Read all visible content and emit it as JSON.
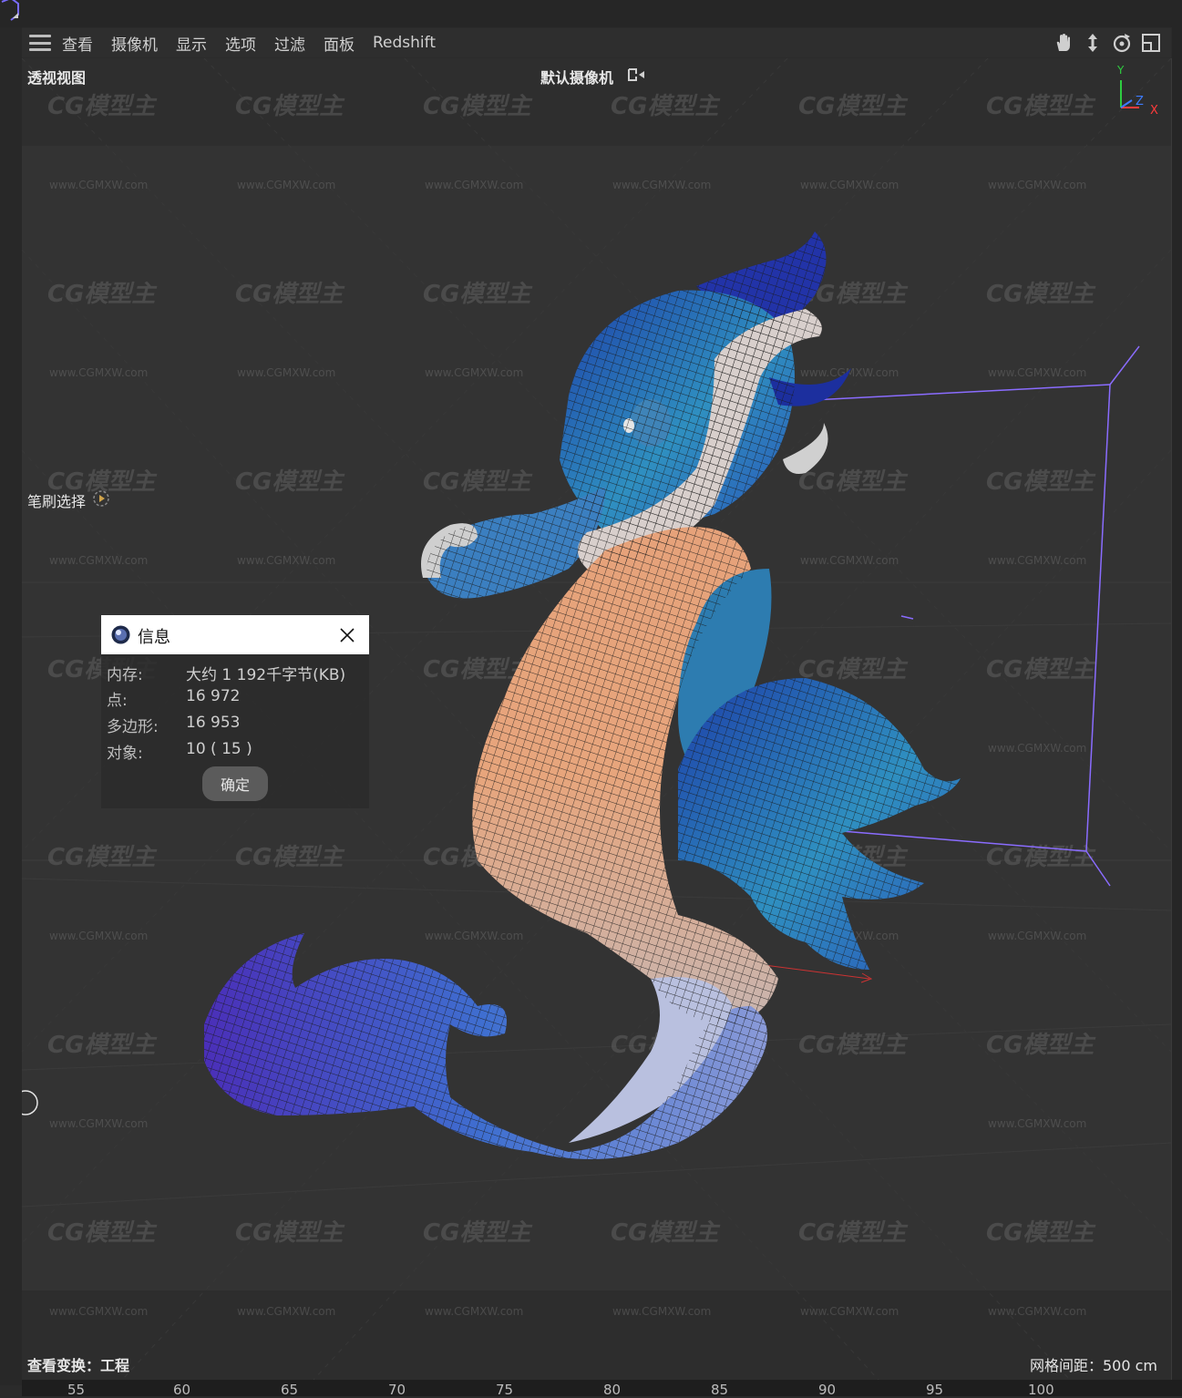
{
  "menubar": {
    "items": [
      "查看",
      "摄像机",
      "显示",
      "选项",
      "过滤",
      "面板",
      "Redshift"
    ]
  },
  "viewport": {
    "view_name": "透视视图",
    "camera_name": "默认摄像机",
    "brush_select": "笔刷选择",
    "view_transform": "查看变换：工程",
    "grid_spacing": "网格间距：500 cm",
    "axis": {
      "y": "Y",
      "z": "Z",
      "x": "X"
    },
    "accent_colors": {
      "bbox": "#8a6cff",
      "axis_y": "#2ecc40",
      "axis_z": "#3d7bff",
      "axis_x": "#ff3b3b"
    }
  },
  "watermark": {
    "logo": "CG模型主",
    "url": "www.CGMXW.com"
  },
  "info_dialog": {
    "title": "信息",
    "rows": [
      {
        "label": "内存:",
        "value": "大约 1 192千字节(KB)"
      },
      {
        "label": "点:",
        "value": "16 972"
      },
      {
        "label": "多边形:",
        "value": "16 953"
      },
      {
        "label": "对象:",
        "value": "10 ( 15 )"
      }
    ],
    "ok_label": "确定"
  },
  "ruler": {
    "ticks": [
      "55",
      "60",
      "65",
      "70",
      "75",
      "80",
      "85",
      "90",
      "95",
      "100"
    ]
  }
}
